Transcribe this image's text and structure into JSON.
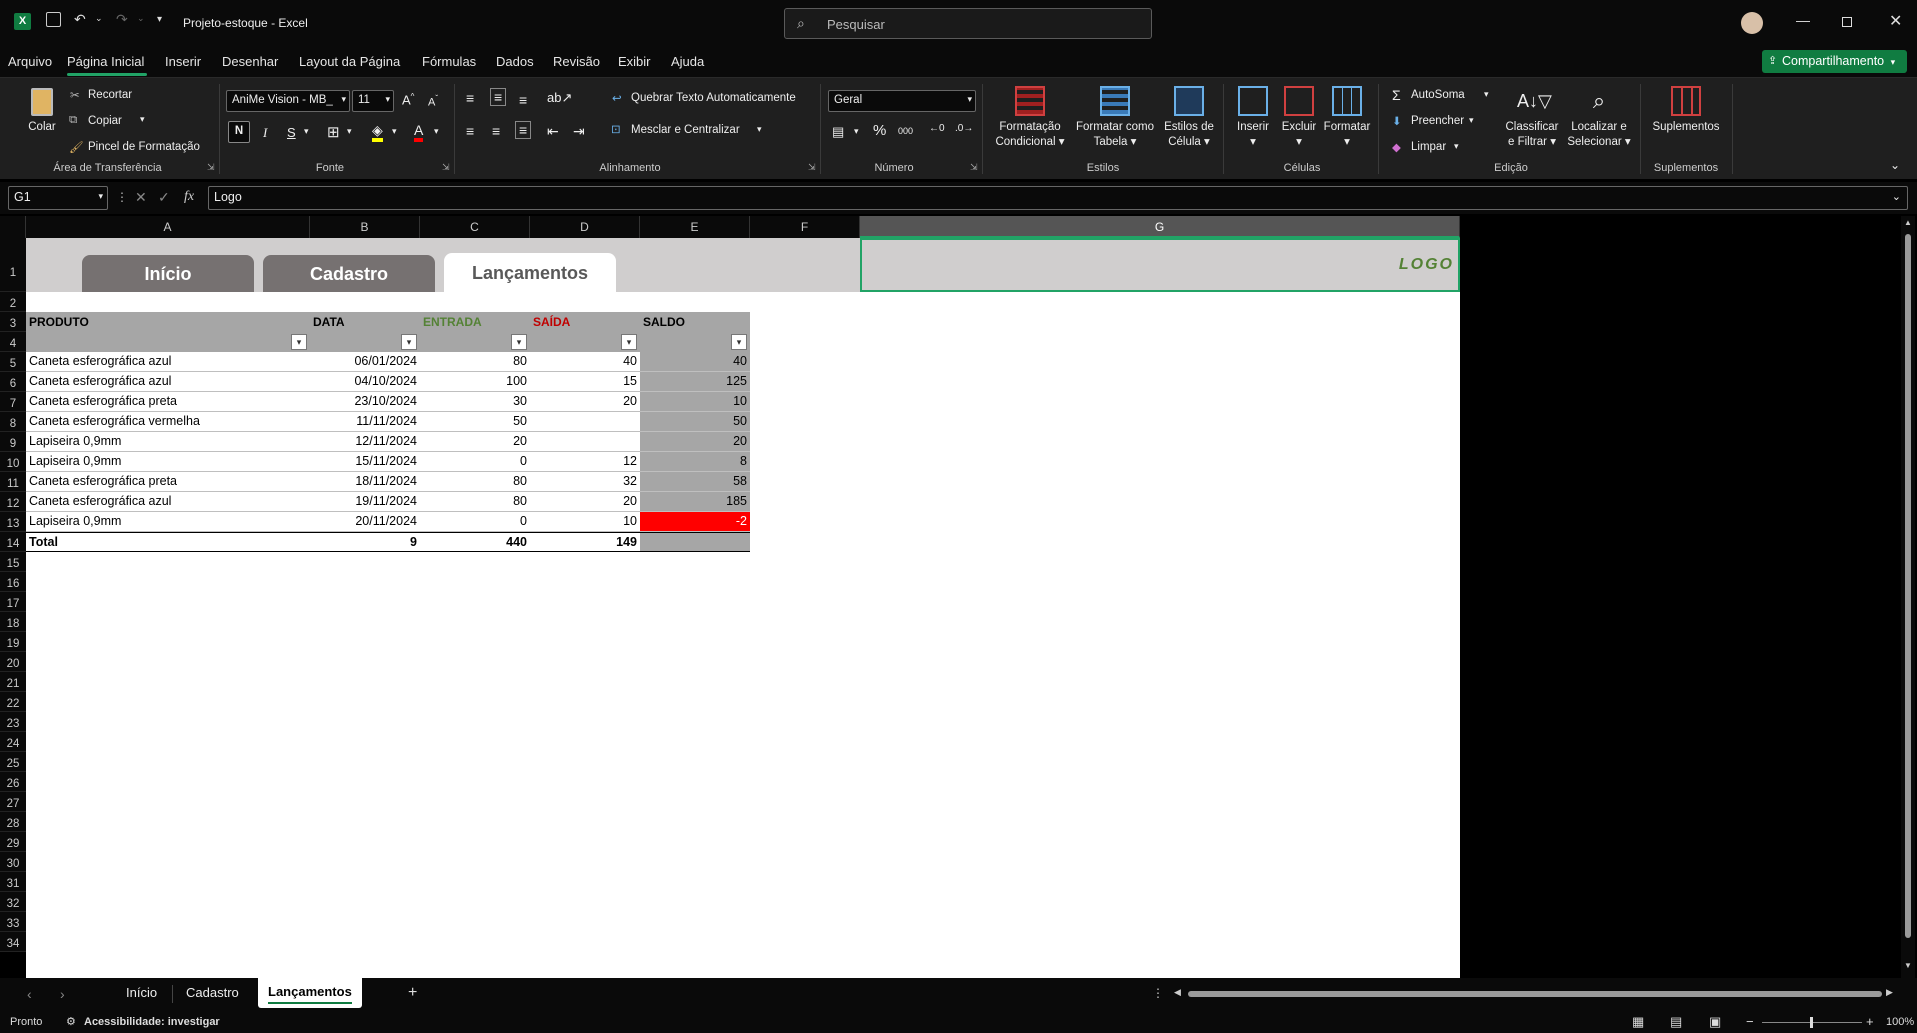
{
  "titlebar": {
    "document_title": "Projeto-estoque",
    "app_name": "Excel",
    "separator": "-",
    "search_placeholder": "Pesquisar"
  },
  "menu": {
    "items": [
      "Arquivo",
      "Página Inicial",
      "Inserir",
      "Desenhar",
      "Layout da Página",
      "Fórmulas",
      "Dados",
      "Revisão",
      "Exibir",
      "Ajuda"
    ],
    "active": "Página Inicial",
    "share_label": "Compartilhamento"
  },
  "ribbon": {
    "clipboard": {
      "paste": "Colar",
      "cut": "Recortar",
      "copy": "Copiar",
      "format_painter": "Pincel de Formatação",
      "label": "Área de Transferência"
    },
    "font": {
      "name": "AniMe Vision - MB_",
      "size": "11",
      "bold": "N",
      "italic": "I",
      "underline": "S",
      "label": "Fonte"
    },
    "alignment": {
      "wrap": "Quebrar Texto Automaticamente",
      "merge": "Mesclar e Centralizar",
      "label": "Alinhamento"
    },
    "number": {
      "format": "Geral",
      "percent": "%",
      "thousands": "000",
      "label": "Número"
    },
    "styles": {
      "conditional": "Formatação",
      "conditional2": "Condicional",
      "table": "Formatar como",
      "table2": "Tabela",
      "cell": "Estilos de",
      "cell2": "Célula",
      "label": "Estilos"
    },
    "cells": {
      "insert": "Inserir",
      "delete": "Excluir",
      "format": "Formatar",
      "label": "Células"
    },
    "editing": {
      "autosum": "AutoSoma",
      "fill": "Preencher",
      "clear": "Limpar",
      "sort": "Classificar",
      "sort2": "e Filtrar",
      "find": "Localizar e",
      "find2": "Selecionar",
      "label": "Edição"
    },
    "addins": {
      "addins": "Suplementos",
      "label": "Suplementos"
    }
  },
  "formula_bar": {
    "name_box": "G1",
    "fx": "fx",
    "content": "Logo"
  },
  "columns": [
    "A",
    "B",
    "C",
    "D",
    "E",
    "F",
    "G"
  ],
  "rows": [
    "1",
    "2",
    "3",
    "4",
    "5",
    "6",
    "7",
    "8",
    "9",
    "10",
    "11",
    "12",
    "13",
    "14",
    "15",
    "16",
    "17",
    "18",
    "19",
    "20",
    "21",
    "22",
    "23",
    "24",
    "25",
    "26",
    "27",
    "28",
    "29",
    "30",
    "31",
    "32",
    "33",
    "34"
  ],
  "nav_tabs": [
    "Início",
    "Cadastro",
    "Lançamentos"
  ],
  "nav_active": "Lançamentos",
  "logo_text": "LOGO",
  "table": {
    "headers": [
      "PRODUTO",
      "DATA",
      "ENTRADA",
      "SAÍDA",
      "SALDO"
    ],
    "rows": [
      [
        "Caneta esferográfica azul",
        "06/01/2024",
        "80",
        "40",
        "40"
      ],
      [
        "Caneta esferográfica azul",
        "04/10/2024",
        "100",
        "15",
        "125"
      ],
      [
        "Caneta esferográfica preta",
        "23/10/2024",
        "30",
        "20",
        "10"
      ],
      [
        "Caneta esferográfica vermelha",
        "11/11/2024",
        "50",
        "",
        "50"
      ],
      [
        "Lapiseira 0,9mm",
        "12/11/2024",
        "20",
        "",
        "20"
      ],
      [
        "Lapiseira 0,9mm",
        "15/11/2024",
        "0",
        "12",
        "8"
      ],
      [
        "Caneta esferográfica preta",
        "18/11/2024",
        "80",
        "32",
        "58"
      ],
      [
        "Caneta esferográfica azul",
        "19/11/2024",
        "80",
        "20",
        "185"
      ],
      [
        "Lapiseira 0,9mm",
        "20/11/2024",
        "0",
        "10",
        "-2"
      ]
    ],
    "total": [
      "Total",
      "9",
      "440",
      "149",
      ""
    ],
    "colors": {
      "entrada": "#548235",
      "saida": "#c00000",
      "negative": "#ff0000",
      "header_bg": "#a6a6a6"
    }
  },
  "sheet_tabs": [
    "Início",
    "Cadastro",
    "Lançamentos"
  ],
  "sheet_active": "Lançamentos",
  "status": {
    "ready": "Pronto",
    "accessibility": "Acessibilidade: investigar",
    "zoom": "100%"
  },
  "accent": "#107c41"
}
